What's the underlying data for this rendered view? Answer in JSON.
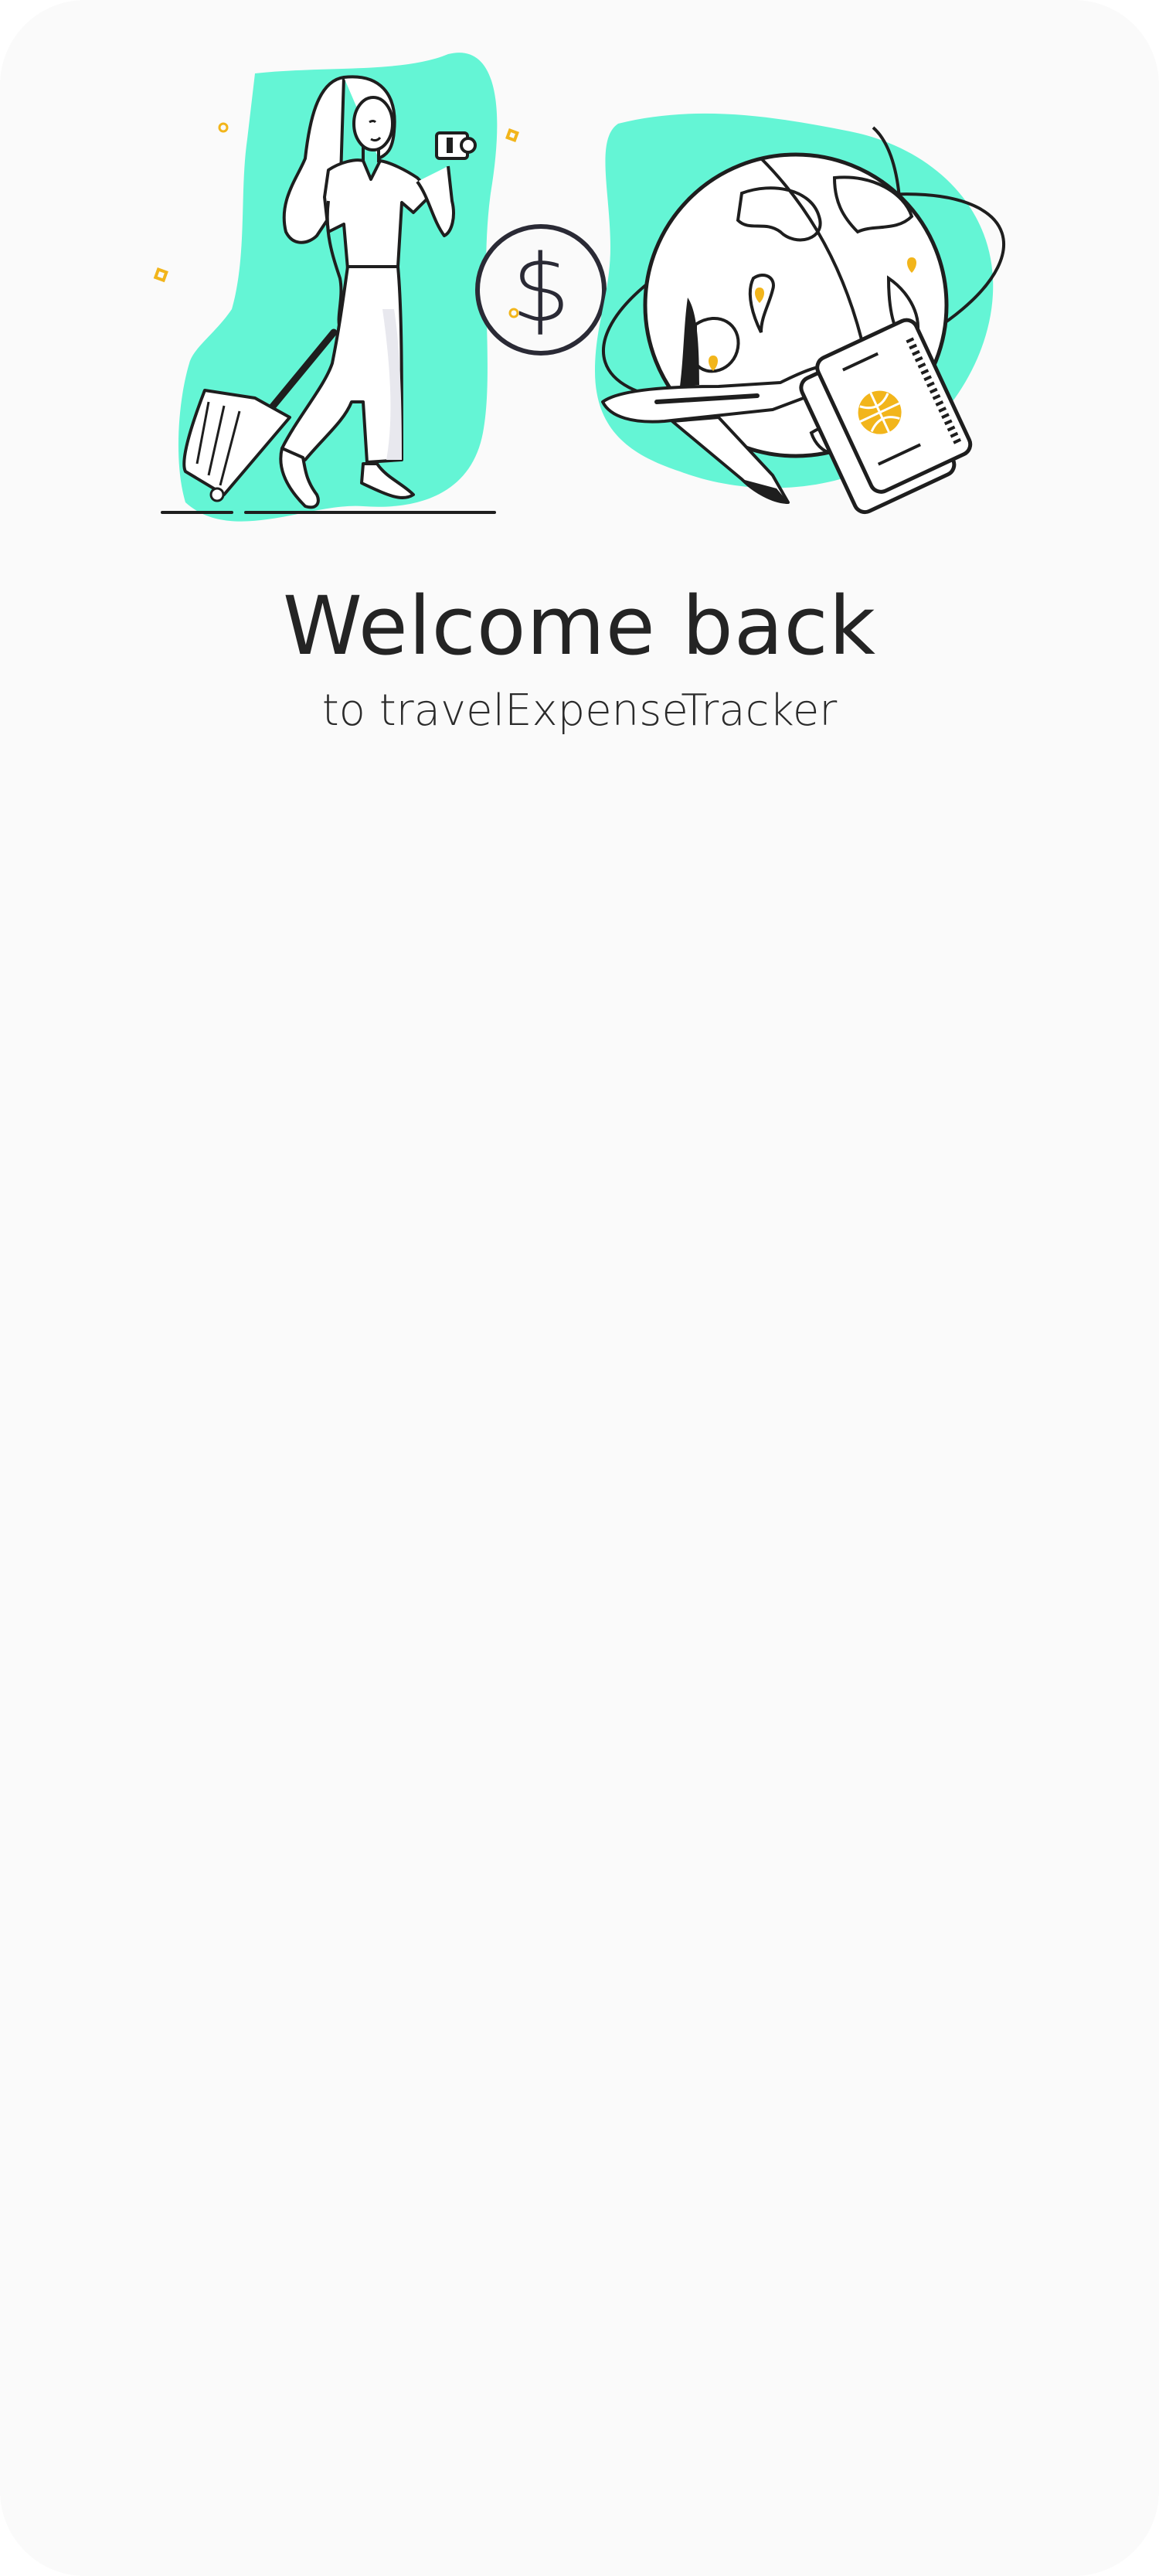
{
  "welcome": {
    "title": "Welcome back",
    "subtitle": "to travelExpenseTracker"
  },
  "illustration": {
    "icons": [
      "traveler-with-suitcase-illustration",
      "dollar-icon",
      "globe-airplane-passport-illustration"
    ],
    "accent_color": "#64f5d5",
    "highlight_color": "#f2b51b",
    "line_color": "#1e1e1e"
  }
}
